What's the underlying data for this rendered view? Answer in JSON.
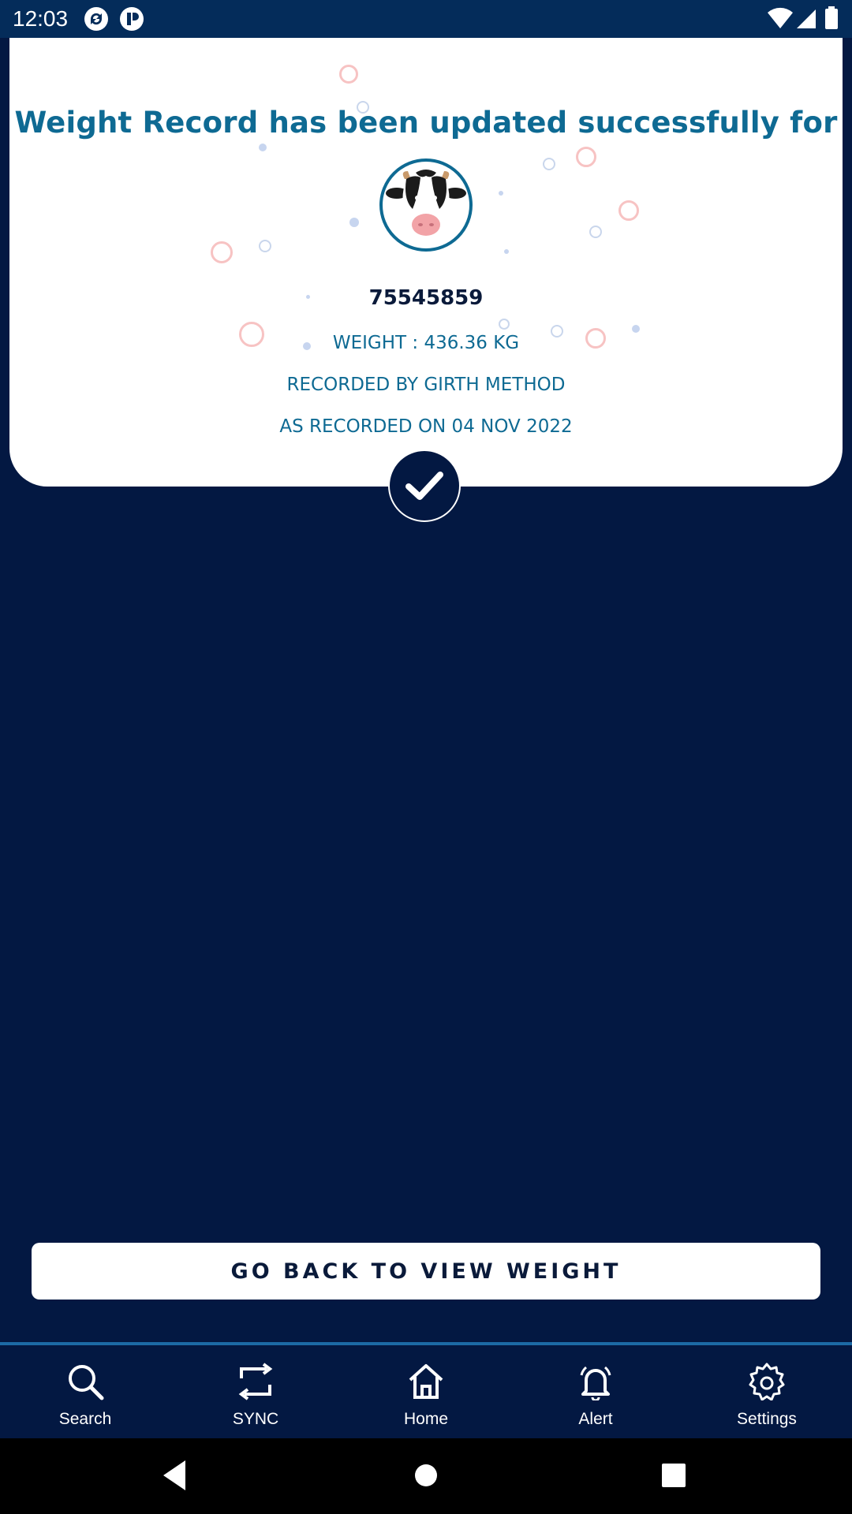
{
  "status_bar": {
    "time": "12:03",
    "left_icons": [
      "sync-app-icon",
      "notification-app-icon"
    ],
    "right_icons": [
      "wifi-icon",
      "signal-icon",
      "battery-icon"
    ]
  },
  "result_card": {
    "title": "Weight Record has been updated successfully for",
    "animal_icon": "cow-face-icon",
    "animal_id": "75545859",
    "weight_line": "WEIGHT : 436.36 KG",
    "method_line": "RECORDED BY GIRTH METHOD",
    "date_line": "AS RECORDED ON 04 NOV 2022",
    "badge_icon": "checkmark-icon"
  },
  "actions": {
    "back_button_label": "GO BACK TO VIEW WEIGHT"
  },
  "bottom_nav": {
    "items": [
      {
        "label": "Search",
        "icon": "search-icon"
      },
      {
        "label": "SYNC",
        "icon": "sync-icon"
      },
      {
        "label": "Home",
        "icon": "home-icon"
      },
      {
        "label": "Alert",
        "icon": "bell-icon"
      },
      {
        "label": "Settings",
        "icon": "gear-icon"
      }
    ]
  },
  "system_nav": {
    "buttons": [
      "back-icon",
      "home-circle-icon",
      "recents-icon"
    ]
  },
  "colors": {
    "background": "#031842",
    "status_bar": "#042c5a",
    "accent_text": "#0e6a93",
    "card": "#ffffff"
  }
}
